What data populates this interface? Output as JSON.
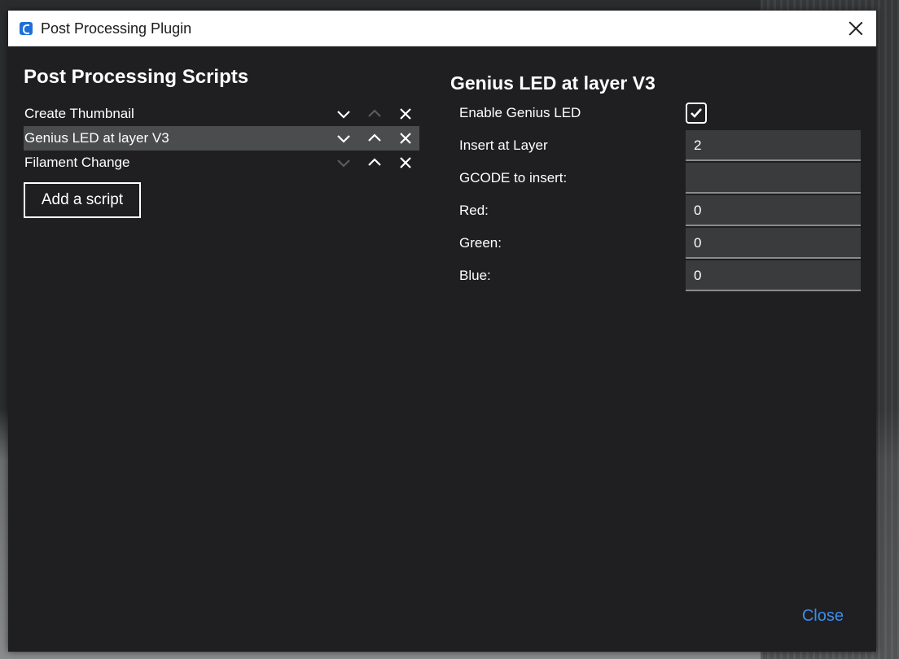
{
  "window": {
    "title": "Post Processing Plugin"
  },
  "left": {
    "heading": "Post Processing Scripts",
    "scripts": [
      {
        "name": "Create Thumbnail",
        "selected": false,
        "can_move_down": true,
        "can_move_up": false
      },
      {
        "name": "Genius LED at layer V3",
        "selected": true,
        "can_move_down": true,
        "can_move_up": true
      },
      {
        "name": "Filament Change",
        "selected": false,
        "can_move_down": false,
        "can_move_up": true
      }
    ],
    "add_button": "Add a script"
  },
  "right": {
    "title": "Genius LED at layer V3",
    "settings": [
      {
        "label": "Enable Genius LED",
        "type": "checkbox",
        "checked": true
      },
      {
        "label": "Insert at Layer",
        "type": "text",
        "value": "2"
      },
      {
        "label": "GCODE to insert:",
        "type": "text",
        "value": ""
      },
      {
        "label": "Red:",
        "type": "text",
        "value": "0"
      },
      {
        "label": "Green:",
        "type": "text",
        "value": "0"
      },
      {
        "label": "Blue:",
        "type": "text",
        "value": "0"
      }
    ]
  },
  "footer": {
    "close_label": "Close"
  },
  "colors": {
    "accent": "#3b8ded",
    "dialog_bg": "#1f1f21",
    "selected_row": "#4b4c4e",
    "field_bg": "#3a3b3d",
    "disabled_icon": "#5a5b5d"
  },
  "icons": {
    "down": "chevron-down-icon",
    "up": "chevron-up-icon",
    "remove": "close-icon",
    "check": "checkmark-icon",
    "app": "cura-app-icon"
  }
}
